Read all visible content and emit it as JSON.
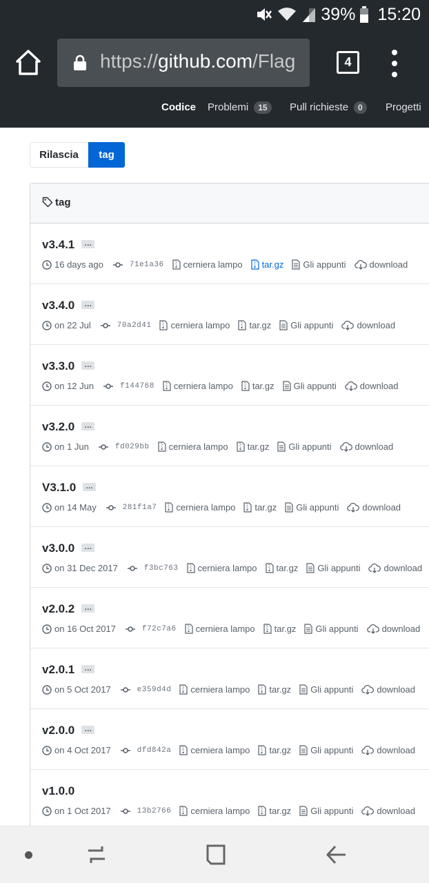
{
  "status_bar": {
    "battery_percent": "39%",
    "time": "15:20"
  },
  "browser": {
    "url_scheme": "https://",
    "url_host": "github.com",
    "url_path": "/Flag",
    "tab_count": "4"
  },
  "repo_nav": {
    "code": "Codice",
    "issues": "Problemi",
    "issues_count": "15",
    "pulls": "Pull richieste",
    "pulls_count": "0",
    "projects": "Progetti"
  },
  "subnav": {
    "releases": "Rilascia",
    "tags": "tag"
  },
  "tag_box": {
    "title": "tag",
    "ellipsis": "…",
    "labels": {
      "zip": "cerniera lampo",
      "tar": "tar.gz",
      "notes": "Gli appunti",
      "download": "download"
    },
    "tags": [
      {
        "name": "v3.4.1",
        "date": "16 days ago",
        "sha": "71e1a36"
      },
      {
        "name": "v3.4.0",
        "date": "on 22 Jul",
        "sha": "70a2d41"
      },
      {
        "name": "v3.3.0",
        "date": "on 12 Jun",
        "sha": "f144768"
      },
      {
        "name": "v3.2.0",
        "date": "on 1 Jun",
        "sha": "fd029bb"
      },
      {
        "name": "V3.1.0",
        "date": "on 14 May",
        "sha": "281f1a7"
      },
      {
        "name": "v3.0.0",
        "date": "on 31 Dec 2017",
        "sha": "f3bc763"
      },
      {
        "name": "v2.0.2",
        "date": "on 16 Oct 2017",
        "sha": "f72c7a6"
      },
      {
        "name": "v2.0.1",
        "date": "on 5 Oct 2017",
        "sha": "e359d4d"
      },
      {
        "name": "v2.0.0",
        "date": "on 4 Oct 2017",
        "sha": "dfd842a"
      },
      {
        "name": "v1.0.0",
        "date": "on 1 Oct 2017",
        "sha": "13b2766"
      }
    ]
  },
  "icons": {
    "mute": "mute-icon",
    "wifi": "wifi-icon",
    "signal": "signal-icon",
    "battery": "battery-icon",
    "home": "home-icon",
    "lock": "lock-icon",
    "menu": "more-vert-icon",
    "tag": "tag-icon",
    "clock": "clock-icon",
    "commit": "commit-icon",
    "zip": "file-zip-icon",
    "notes": "file-text-icon",
    "download": "cloud-download-icon",
    "nav_recents": "recents-icon",
    "nav_home": "nav-home-icon",
    "nav_back": "back-icon"
  },
  "colors": {
    "header_bg": "#24292e",
    "accent_blue": "#0366d6",
    "muted_text": "#586069"
  }
}
